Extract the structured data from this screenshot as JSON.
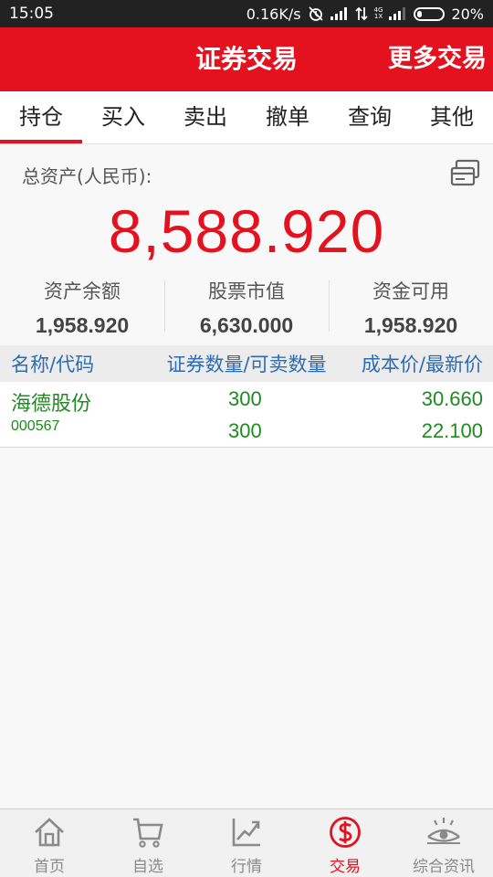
{
  "status_bar": {
    "time": "15:05",
    "network_speed": "0.16K/s",
    "signal_type": "4G",
    "signal_type2": "1X",
    "battery_text": "20%",
    "battery_level": 0.2
  },
  "header": {
    "title": "证券交易",
    "more_label": "更多交易"
  },
  "tabs": [
    {
      "label": "持仓",
      "active": true
    },
    {
      "label": "买入"
    },
    {
      "label": "卖出"
    },
    {
      "label": "撤单"
    },
    {
      "label": "查询"
    },
    {
      "label": "其他"
    }
  ],
  "assets": {
    "total_label": "总资产(人民币):",
    "total_value": "8,588.920",
    "items": [
      {
        "label": "资产余额",
        "value": "1,958.920"
      },
      {
        "label": "股票市值",
        "value": "6,630.000"
      },
      {
        "label": "资金可用",
        "value": "1,958.920"
      }
    ]
  },
  "table": {
    "headers": [
      "名称/代码",
      "证券数量/可卖数量",
      "成本价/最新价"
    ],
    "rows": [
      {
        "name": "海德股份",
        "code": "000567",
        "quantity": "300",
        "sellable": "300",
        "cost_price": "30.660",
        "latest_price": "22.100"
      }
    ]
  },
  "bottom_nav": [
    {
      "label": "首页",
      "icon": "home-icon"
    },
    {
      "label": "自选",
      "icon": "cart-icon"
    },
    {
      "label": "行情",
      "icon": "chart-icon"
    },
    {
      "label": "交易",
      "icon": "dollar-icon",
      "active": true
    },
    {
      "label": "综合资讯",
      "icon": "eye-icon"
    }
  ],
  "colors": {
    "brand_red": "#e4121f",
    "stock_green": "#1f8a1f",
    "header_blue": "#2d6cb5"
  }
}
